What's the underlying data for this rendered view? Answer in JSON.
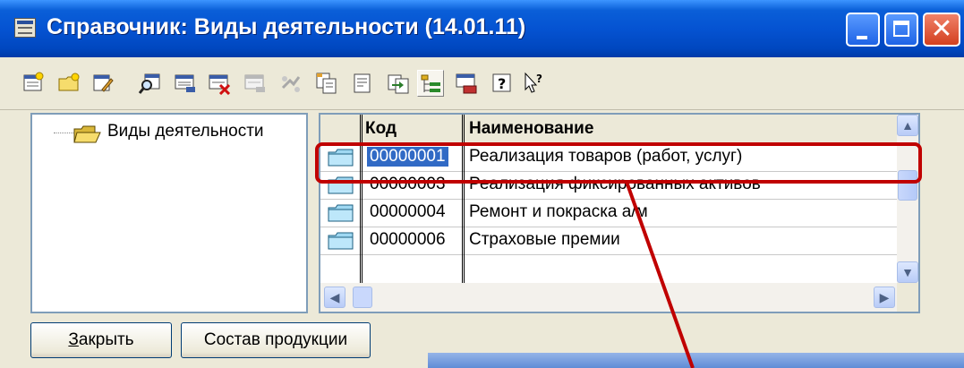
{
  "window": {
    "title": "Справочник: Виды деятельности (14.01.11)"
  },
  "toolbar": {
    "items": [
      "new-item-icon",
      "new-folder-icon",
      "edit-icon",
      "find-icon",
      "copy-row-icon",
      "delete-row-icon",
      "disabled-row-icon",
      "disabled-link-icon",
      "copy-icon",
      "document-icon",
      "move-icon",
      "tree-view-icon",
      "select-icon",
      "help-icon",
      "context-help-icon"
    ],
    "active": "tree-view-icon"
  },
  "tree": {
    "root_label": "Виды деятельности"
  },
  "grid": {
    "columns": {
      "code": "Код",
      "name": "Наименование"
    },
    "rows": [
      {
        "code": "00000001",
        "name": "Реализация товаров (работ, услуг)",
        "selected": true
      },
      {
        "code": "00000003",
        "name": "Реализация фиксированных активов",
        "selected": false
      },
      {
        "code": "00000004",
        "name": "Ремонт и покраска а/м",
        "selected": false
      },
      {
        "code": "00000006",
        "name": "Страховые премии",
        "selected": false
      }
    ]
  },
  "buttons": {
    "close": "Закрыть",
    "products": "Состав продукции"
  },
  "colors": {
    "selection": "#316ac5",
    "annotation": "#c00000",
    "title_bar": "#0553d2"
  }
}
